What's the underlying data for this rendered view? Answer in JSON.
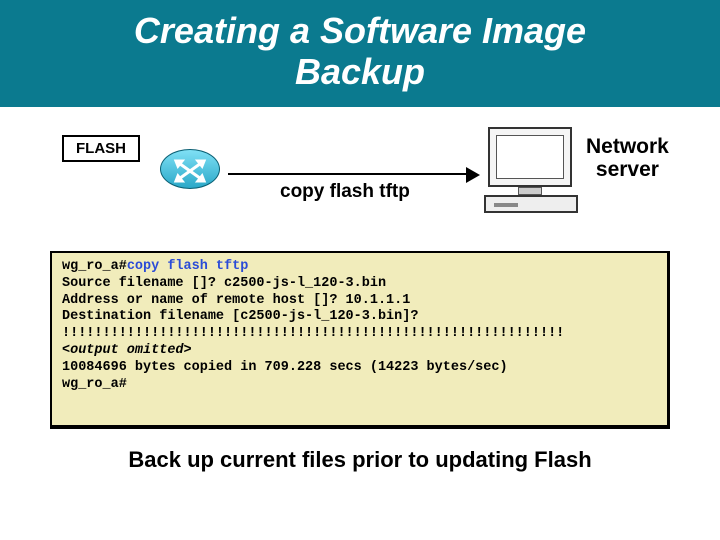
{
  "slide": {
    "title_line1": "Creating a Software Image",
    "title_line2": "Backup"
  },
  "diagram": {
    "flash_label": "FLASH",
    "arrow_caption": "copy flash tftp",
    "server_label_line1": "Network",
    "server_label_line2": "server"
  },
  "terminal": {
    "prompt1_prefix": "wg_ro_a#",
    "prompt1_cmd": "copy flash tftp",
    "line2": "Source filename []? c2500-js-l_120-3.bin",
    "line3": "Address or name of remote host []? 10.1.1.1",
    "line4": "Destination filename [c2500-js-l_120-3.bin]?",
    "line5": "!!!!!!!!!!!!!!!!!!!!!!!!!!!!!!!!!!!!!!!!!!!!!!!!!!!!!!!!!!!!!!",
    "line6": "<output omitted>",
    "line7": "10084696 bytes copied in 709.228 secs (14223 bytes/sec)",
    "line8": "wg_ro_a#"
  },
  "footer": {
    "note": "Back up current files prior to updating Flash"
  }
}
